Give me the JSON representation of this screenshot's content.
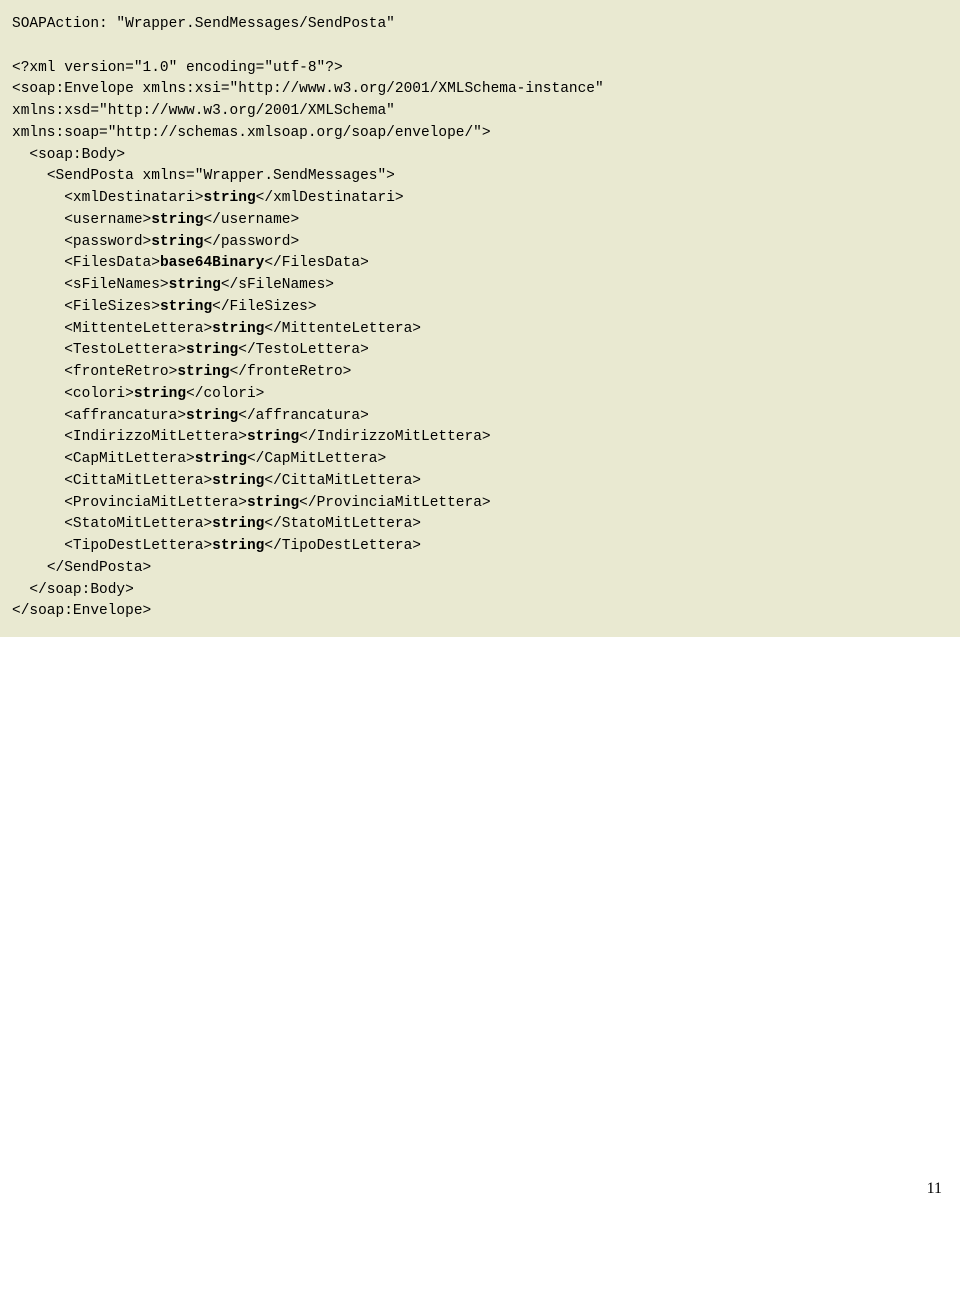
{
  "soapaction": "SOAPAction: \"Wrapper.SendMessages/SendPosta\"",
  "xmldecl": "<?xml version=\"1.0\" encoding=\"utf-8\"?>",
  "env_open_1": "<soap:Envelope xmlns:xsi=\"http://www.w3.org/2001/XMLSchema-instance\" ",
  "env_open_2": "xmlns:xsd=\"http://www.w3.org/2001/XMLSchema\" ",
  "env_open_3": "xmlns:soap=\"http://schemas.xmlsoap.org/soap/envelope/\">",
  "body_open": "<soap:Body>",
  "sendposta_open": "<SendPosta xmlns=\"Wrapper.SendMessages\">",
  "tags": {
    "xmlDestinatari": {
      "open": "<xmlDestinatari>",
      "val": "string",
      "close": "</xmlDestinatari>"
    },
    "username": {
      "open": "<username>",
      "val": "string",
      "close": "</username>"
    },
    "password": {
      "open": "<password>",
      "val": "string",
      "close": "</password>"
    },
    "FilesData": {
      "open": "<FilesData>",
      "val": "base64Binary",
      "close": "</FilesData>"
    },
    "sFileNames": {
      "open": "<sFileNames>",
      "val": "string",
      "close": "</sFileNames>"
    },
    "FileSizes": {
      "open": "<FileSizes>",
      "val": "string",
      "close": "</FileSizes>"
    },
    "MittenteLettera": {
      "open": "<MittenteLettera>",
      "val": "string",
      "close": "</MittenteLettera>"
    },
    "TestoLettera": {
      "open": "<TestoLettera>",
      "val": "string",
      "close": "</TestoLettera>"
    },
    "fronteRetro": {
      "open": "<fronteRetro>",
      "val": "string",
      "close": "</fronteRetro>"
    },
    "colori": {
      "open": "<colori>",
      "val": "string",
      "close": "</colori>"
    },
    "affrancatura": {
      "open": "<affrancatura>",
      "val": "string",
      "close": "</affrancatura>"
    },
    "IndirizzoMitLettera": {
      "open": "<IndirizzoMitLettera>",
      "val": "string",
      "close": "</IndirizzoMitLettera>"
    },
    "CapMitLettera": {
      "open": "<CapMitLettera>",
      "val": "string",
      "close": "</CapMitLettera>"
    },
    "CittaMitLettera": {
      "open": "<CittaMitLettera>",
      "val": "string",
      "close": "</CittaMitLettera>"
    },
    "ProvinciaMitLettera": {
      "open": "<ProvinciaMitLettera>",
      "val": "string",
      "close": "</ProvinciaMitLettera>"
    },
    "StatoMitLettera": {
      "open": "<StatoMitLettera>",
      "val": "string",
      "close": "</StatoMitLettera>"
    },
    "TipoDestLettera": {
      "open": "<TipoDestLettera>",
      "val": "string",
      "close": "</TipoDestLettera>"
    }
  },
  "sendposta_close": "</SendPosta>",
  "body_close": "</soap:Body>",
  "env_close": "</soap:Envelope>",
  "page_number": "11"
}
